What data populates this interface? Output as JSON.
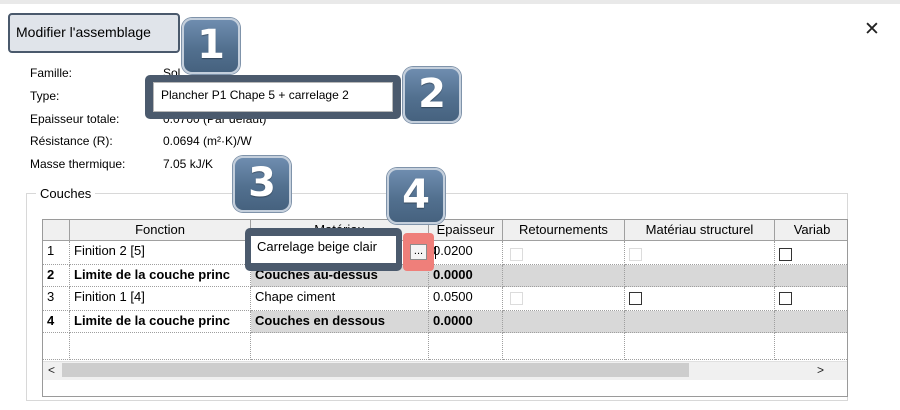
{
  "dialog": {
    "title": "Modifier l'assemblage",
    "close_symbol": "✕"
  },
  "badges": [
    "1",
    "2",
    "3",
    "4"
  ],
  "properties": [
    {
      "label": "Famille:",
      "value": "Sol"
    },
    {
      "label": "Type:",
      "value": "Plancher P1 Chape 5 + carrelage 2"
    },
    {
      "label": "Epaisseur totale:",
      "value": "0.0700 (Par défaut)"
    },
    {
      "label": "Résistance (R):",
      "value": "0.0694 (m²·K)/W"
    },
    {
      "label": "Masse thermique:",
      "value": "7.05 kJ/K"
    }
  ],
  "couches": {
    "group_label": "Couches",
    "columns": [
      "Fonction",
      "Matériau",
      "Epaisseur",
      "Retournements",
      "Matériau structurel",
      "Variab"
    ],
    "rows": [
      {
        "num": "1",
        "fonction": "Finition 2 [5]",
        "materiau": "Carrelage beige clair",
        "epaisseur": "0.0200",
        "bold": false
      },
      {
        "num": "2",
        "fonction": "Limite de la couche princ",
        "materiau": "Couches au-dessus",
        "epaisseur": "0.0000",
        "bold": true
      },
      {
        "num": "3",
        "fonction": "Finition 1 [4]",
        "materiau": "Chape ciment",
        "epaisseur": "0.0500",
        "bold": false
      },
      {
        "num": "4",
        "fonction": "Limite de la couche princ",
        "materiau": "Couches en dessous",
        "epaisseur": "0.0000",
        "bold": true
      }
    ],
    "ellipsis_label": "...",
    "scroll_left": "<",
    "scroll_right": ">"
  },
  "icons": {
    "close": "close-icon",
    "scroll_left": "chevron-left-icon",
    "scroll_right": "chevron-right-icon"
  },
  "colors": {
    "badge": "#52708f",
    "highlight_box": "#4b5a6d",
    "ellipsis_highlight": "#ef7f7a",
    "boundary_row": "#d8d8d8"
  }
}
